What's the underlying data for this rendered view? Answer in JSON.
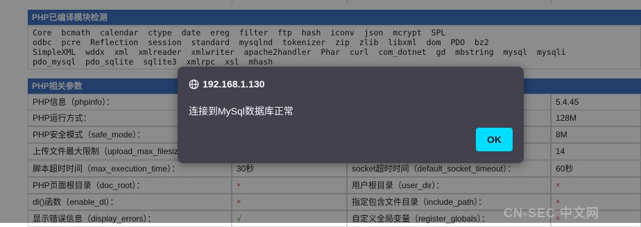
{
  "modules_section": {
    "title": "PHP已编译模块检测",
    "lines": [
      "Core  bcmath  calendar  ctype  date  ereg  filter  ftp  hash  iconv  json  mcrypt  SPL",
      "odbc  pcre  Reflection  session  standard  mysqlnd  tokenizer  zip  zlib  libxml  dom  PDO  bz2",
      "SimpleXML  wddx  xml  xmlreader  xmlwriter  apache2handler  Phar  curl  com_dotnet  gd  mbstring  mysql  mysqli",
      "pdo_mysql  pdo_sqlite  sqlite3  xmlrpc  xsl  mhash"
    ]
  },
  "params_section": {
    "title": "PHP相关参数",
    "rows": [
      {
        "k1": "PHP信息（phpinfo）：",
        "v1": "",
        "k2": "",
        "v2": "5.4.45"
      },
      {
        "k1": "PHP运行方式：",
        "v1": "",
        "k2": "",
        "v2": "128M"
      },
      {
        "k1": "PHP安全模式（safe_mode）：",
        "v1": "",
        "k2": "",
        "v2": "8M"
      },
      {
        "k1": "上传文件最大限制（upload_max_filesiz",
        "v1": "",
        "k2": "",
        "v2": "14"
      },
      {
        "k1": "脚本超时时间（max_execution_time）：",
        "v1": "30秒",
        "k2": "socket超时时间（default_socket_timeout）：",
        "v2": "60秒"
      },
      {
        "k1": "PHP页面根目录（doc_root）：",
        "v1": "×",
        "k2": "用户根目录（user_dir）：",
        "v2": "×"
      },
      {
        "k1": "dl()函数（enable_dl）：",
        "v1": "×",
        "k2": "指定包含文件目录（include_path）：",
        "v2": "×"
      },
      {
        "k1": "显示错误信息（display_errors）：",
        "v1": "√",
        "k2": "自定义全局变量（register_globals）：",
        "v2": "×"
      }
    ]
  },
  "dialog": {
    "origin": "192.168.1.130",
    "message": "连接到MySql数据库正常",
    "ok_label": "OK"
  },
  "watermark": "CN-SEC 中文网",
  "colors": {
    "header_bg": "#3f74c4",
    "dialog_bg": "#42414d",
    "ok_button": "#00ddff",
    "cross": "#e03b3b",
    "check": "#2e9b2e"
  }
}
